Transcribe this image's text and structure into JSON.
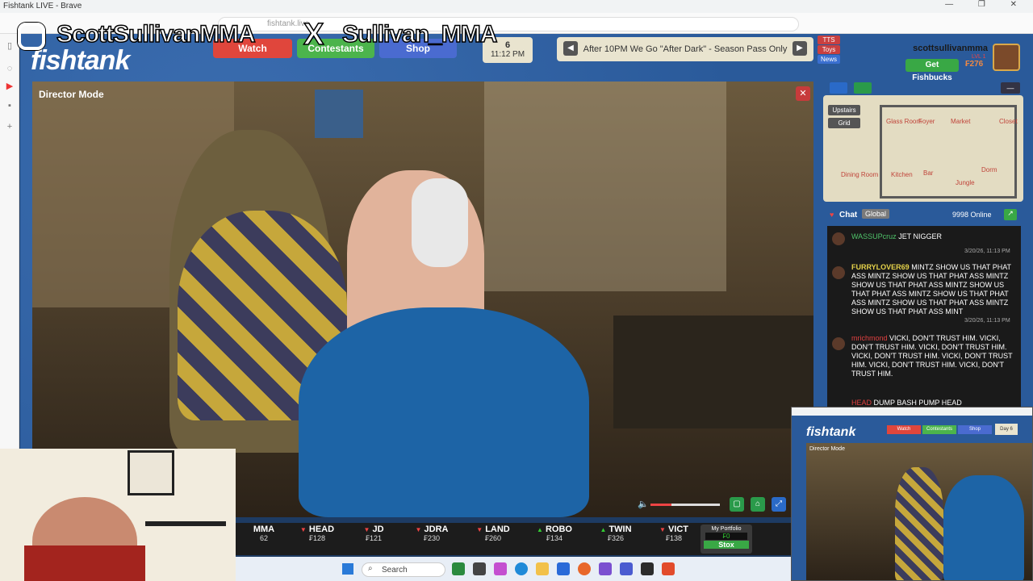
{
  "browser": {
    "title": "Fishtank LIVE - Brave",
    "url": "fishtank.live",
    "win_controls": "— ❐ ✕"
  },
  "site": {
    "logo": "fishtank",
    "nav": [
      {
        "label": "Watch",
        "color": "#e0463c"
      },
      {
        "label": "Contestants",
        "color": "#4cb44c"
      },
      {
        "label": "Shop",
        "color": "#4a6bd0"
      }
    ],
    "clock": {
      "day": "6",
      "time": "11:12 PM"
    },
    "banner": {
      "text": "After 10PM We Go \"After Dark\" - Season Pass Only",
      "prev": "◀",
      "next": "▶"
    },
    "side_tags": [
      {
        "label": "TTS",
        "color": "#c94040"
      },
      {
        "label": "Toys",
        "color": "#c94040"
      },
      {
        "label": "News",
        "color": "#3a6fd0"
      }
    ],
    "user": {
      "name": "scottsullivanmma",
      "fishbucks_label": "Get Fishbucks",
      "fishbucks_amount": "₣276",
      "level": "LVL 1"
    }
  },
  "player": {
    "mode_label": "Director Mode",
    "close": "✕",
    "volume_percent": 30
  },
  "map": {
    "tabs": [
      "Upstairs",
      "Grid"
    ],
    "rooms": [
      "Glass Room",
      "Foyer",
      "Market",
      "Closet",
      "Dining Room",
      "Kitchen",
      "Bar",
      "Dorm",
      "Jungle"
    ]
  },
  "chat": {
    "label": "Chat",
    "channel": "Global",
    "online": "9998 Online",
    "messages": [
      {
        "user": "WASSUPcruz",
        "user_color": "#4fc36a",
        "text": "JET NIGGER",
        "time": "3/20/26, 11:13 PM"
      },
      {
        "user": "FURRYLOVER69",
        "user_color": "#e6d34a",
        "text": "MINTZ SHOW US THAT PHAT ASS MINTZ SHOW US THAT PHAT ASS MINTZ SHOW US THAT PHAT ASS MINTZ SHOW US THAT PHAT ASS MINTZ SHOW US THAT PHAT ASS MINTZ SHOW US THAT PHAT ASS MINTZ SHOW US THAT PHAT ASS MINT",
        "time": "3/20/26, 11:13 PM"
      },
      {
        "user": "mrichmond",
        "user_color": "#e04040",
        "text": "VICKI, DON'T TRUST HIM. VICKI, DON'T TRUST HIM. VICKI, DON'T TRUST HIM. VICKI, DON'T TRUST HIM. VICKI, DON'T TRUST HIM. VICKI, DON'T TRUST HIM. VICKI, DON'T TRUST HIM.",
        "time": ""
      },
      {
        "user": "HEAD",
        "user_color": "#e04040",
        "text": "DUMP BASH PUMP HEAD",
        "time": ""
      }
    ]
  },
  "ticker": [
    {
      "name": "MMA",
      "price": "62",
      "dir": ""
    },
    {
      "name": "HEAD",
      "price": "₣128",
      "dir": "▼"
    },
    {
      "name": "JD",
      "price": "₣121",
      "dir": "▼"
    },
    {
      "name": "JDRA",
      "price": "₣230",
      "dir": "▼"
    },
    {
      "name": "LAND",
      "price": "₣260",
      "dir": "▼"
    },
    {
      "name": "ROBO",
      "price": "₣134",
      "dir": "▲"
    },
    {
      "name": "TWIN",
      "price": "₣326",
      "dir": "▲"
    },
    {
      "name": "VICT",
      "price": "₣138",
      "dir": "▼"
    }
  ],
  "portfolio": {
    "label": "My Portfolio",
    "value": "₣0",
    "button": "Stox"
  },
  "taskbar": {
    "search": "Search"
  },
  "overlay": {
    "instagram": "ScottSullivanMMA",
    "x_handle": "Sullivan_MMA"
  },
  "pip": {
    "logo": "fishtank",
    "nav": [
      "Watch",
      "Contestants",
      "Shop"
    ],
    "mode_label": "Director Mode",
    "day": "Day 6"
  }
}
